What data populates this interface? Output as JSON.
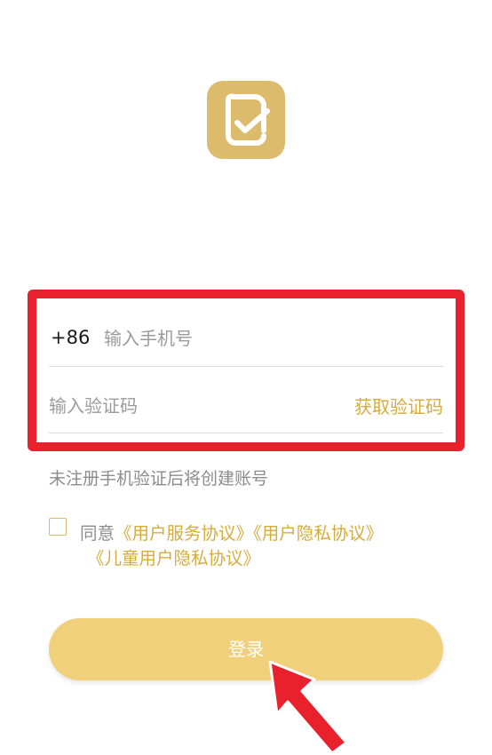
{
  "login": {
    "logo_icon": "check-document-icon",
    "phone": {
      "country_code": "+86",
      "placeholder": "输入手机号",
      "value": ""
    },
    "code": {
      "placeholder": "输入验证码",
      "value": "",
      "get_code_label": "获取验证码"
    },
    "hint": "未注册手机验证后将创建账号",
    "agreement": {
      "prefix": "同意",
      "service_link": "《用户服务协议》",
      "privacy_link": "《用户隐私协议》",
      "children_privacy_link": "《儿童用户隐私协议》",
      "checked": false
    },
    "login_button_label": "登录"
  },
  "annotations": {
    "highlight_color": "#e8212d",
    "arrow_color": "#e8212d"
  },
  "colors": {
    "accent": "#d5ac3c",
    "logo_bg": "#dcbc6c",
    "button_bg": "#f0d07b"
  }
}
